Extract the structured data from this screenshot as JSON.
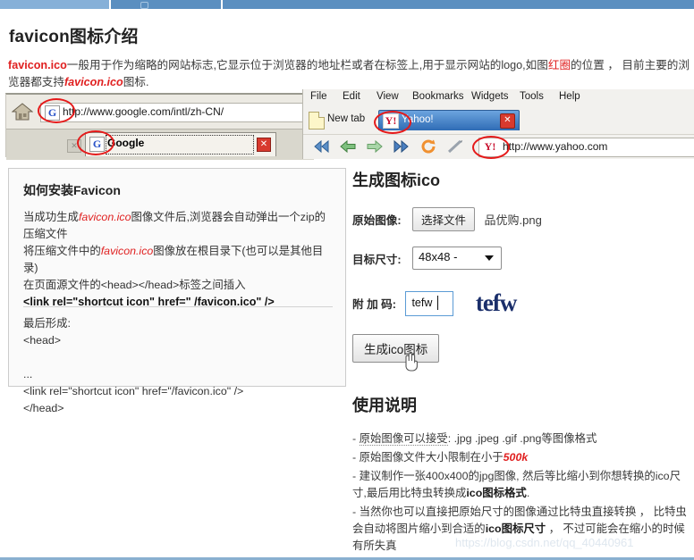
{
  "topbar": {
    "tab_icon": "tab-icon"
  },
  "page_title": "favicon图标介绍",
  "intro": {
    "part1": "favicon.ico",
    "part2": "一般用于作为缩略的网站标志,它显示位于浏览器的地址栏或者在标签上,用于显示网站的logo,如图",
    "part3": "红圈",
    "part4": "的位置 ， 目前主要的浏览器都支持",
    "part5": "favicon.ico",
    "part6": "图标."
  },
  "google_browser": {
    "home_icon": "home-icon",
    "favicon_letter": "G",
    "url": "http://www.google.com/intl/zh-CN/",
    "tab_title": "Google",
    "tab_close": "✕",
    "small_close": "✕"
  },
  "opera_browser": {
    "menu": [
      "File",
      "Edit",
      "View",
      "Bookmarks",
      "Widgets",
      "Tools",
      "Help"
    ],
    "new_tab_label": "New tab",
    "tab_favicon": "Y!",
    "tab_title": "Yahoo!",
    "tab_close": "✕",
    "toolbar_icons": [
      "rewind-icon",
      "back-icon",
      "forward-icon",
      "fast-forward-icon",
      "reload-icon",
      "edit-icon"
    ],
    "addr_favicon": "Y!",
    "url": "http://www.yahoo.com"
  },
  "card": {
    "heading": "如何安装Favicon",
    "line1_a": "当成功生成",
    "line1_b": "favicon.ico",
    "line1_c": "图像文件后,浏览器会自动弹出一个zip的压缩文件",
    "line2_a": "将压缩文件中的",
    "line2_b": "favicon.ico",
    "line2_c": "图像放在根目录下(也可以是其他目录)",
    "line3": "在页面源文件的<head></head>标签之间插入",
    "line4": "<link rel=\"shortcut icon\" href=\" /favicon.ico\" />",
    "line5": "最后形成:",
    "line6": "<head>",
    "line7": "...",
    "line8": "<link rel=\"shortcut icon\" href=\"/favicon.ico\" />",
    "line9": "</head>"
  },
  "form": {
    "heading": "生成图标ico",
    "source_label": "原始图像:",
    "choose_file_button": "选择文件",
    "file_name": "品优购.png",
    "size_label": "目标尺寸:",
    "size_value": "48x48 -",
    "code_label": "附 加 码:",
    "code_value": "tefw",
    "code_preview": "tefw",
    "submit_button": "生成ico图标",
    "cursor_icon": "hand-pointer-icon"
  },
  "usage": {
    "heading": "使用说明",
    "n1_a": "- ",
    "n1_b": "原始图像可以接受",
    "n1_c": ": .jpg .jpeg .gif .png等图像格式",
    "n2_a": "- 原始图像文件大小限制在小于",
    "n2_b": "500k",
    "n3_a": "- 建议制作一张400x400的jpg图像, 然后等比缩小到你想转换的ico尺寸,最后用比特虫转换成",
    "n3_b": "ico图标格式",
    "n3_c": ".",
    "n4_a": "- 当然你也可以直接把原始尺寸的图像通过比特虫直接转换 ， 比特虫会自动将图片缩小到合适的",
    "n4_b": "ico图标尺寸",
    "n4_c": " ， 不过可能会在缩小的时候有所失真"
  },
  "watermark": "https://blog.csdn.net/qq_40440961",
  "colors": {
    "accent_red": "#e02020",
    "topbar_blue": "#5b8fc0",
    "topbar_light_blue": "#86b0d8",
    "preview_navy": "#1b2f6b"
  }
}
